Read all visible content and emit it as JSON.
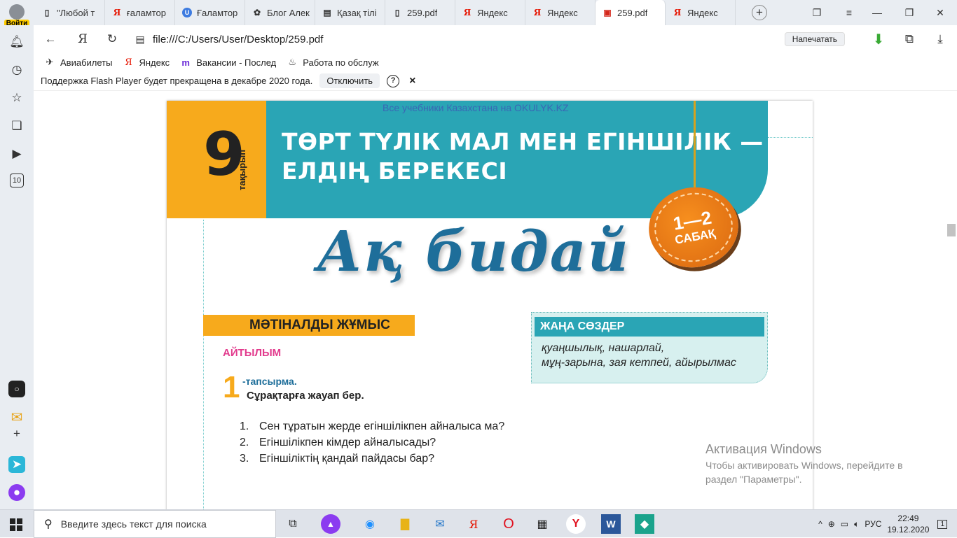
{
  "profile": {
    "login_label": "Войти"
  },
  "tabs": [
    {
      "title": "\"Любой т",
      "icon": "doc-icon"
    },
    {
      "title": "ғаламтор",
      "icon": "yandex-icon"
    },
    {
      "title": "Ғаламтор",
      "icon": "ucoz-icon"
    },
    {
      "title": "Блог Алек",
      "icon": "flower-icon"
    },
    {
      "title": "Қазақ тілі",
      "icon": "books-icon"
    },
    {
      "title": "259.pdf",
      "icon": "doc-icon"
    },
    {
      "title": "Яндекс",
      "icon": "yandex-icon"
    },
    {
      "title": "Яндекс",
      "icon": "yandex-icon"
    },
    {
      "title": "259.pdf",
      "icon": "pdf-icon",
      "active": true
    },
    {
      "title": "Яндекс",
      "icon": "yandex-icon"
    }
  ],
  "address": {
    "url": "file:///C:/Users/User/Desktop/259.pdf",
    "print_label": "Напечатать"
  },
  "bookmarks": [
    {
      "label": "Авиабилеты",
      "icon": "plane-icon"
    },
    {
      "label": "Яндекс",
      "icon": "yandex-icon"
    },
    {
      "label": "Вакансии - Послед",
      "icon": "m-icon"
    },
    {
      "label": "Работа по обслуж",
      "icon": "flame-icon"
    }
  ],
  "infobar": {
    "message": "Поддержка Flash Player будет прекращена в декабре 2020 года.",
    "button": "Отключить",
    "help": "?",
    "close": "×"
  },
  "sidebar": {
    "tab_count": "10"
  },
  "pdf": {
    "watermark": "Все учебники Казахстана на OKULYK.KZ",
    "topic_number": "9",
    "topic_label": "тақырып",
    "title_line1": "ТӨРТ ТҮЛІК МАЛ МЕН ЕГІНШІЛІК —",
    "title_line2": "ЕЛДІҢ БЕРЕКЕСІ",
    "badge_number": "1—2",
    "badge_label": "САБАҚ",
    "lesson_title": "Ақ   бидай",
    "section": "МӘТІНАЛДЫ ЖҰМЫС",
    "subsection": "АЙТЫЛЫМ",
    "task_number": "1",
    "task_label": "-тапсырма.",
    "task_text": "Сұрақтарға жауап бер.",
    "questions": [
      {
        "n": "1.",
        "text": "Сен тұратын жерде егіншілікпен айналыса ма?"
      },
      {
        "n": "2.",
        "text": "Егіншілікпен кімдер айналысады?"
      },
      {
        "n": "3.",
        "text": "Егіншіліктің қандай пайдасы бар?"
      }
    ],
    "new_words_title": "ЖАҢА СӨЗДЕР",
    "new_words_line1": "қуаңшылық, нашарлай,",
    "new_words_line2": "мұң-зарына, зая кетпей, айырылмас"
  },
  "activation": {
    "title": "Активация Windows",
    "line1": "Чтобы активировать Windows, перейдите в",
    "line2": "раздел \"Параметры\"."
  },
  "taskbar": {
    "search_placeholder": "Введите здесь текст для поиска",
    "lang": "РУС",
    "time": "22:49",
    "date": "19.12.2020",
    "notif_count": "1"
  },
  "colors": {
    "orange": "#f7aa1c",
    "teal": "#2aa5b5",
    "title_blue": "#1e6e9a",
    "pink": "#e23b8d"
  }
}
